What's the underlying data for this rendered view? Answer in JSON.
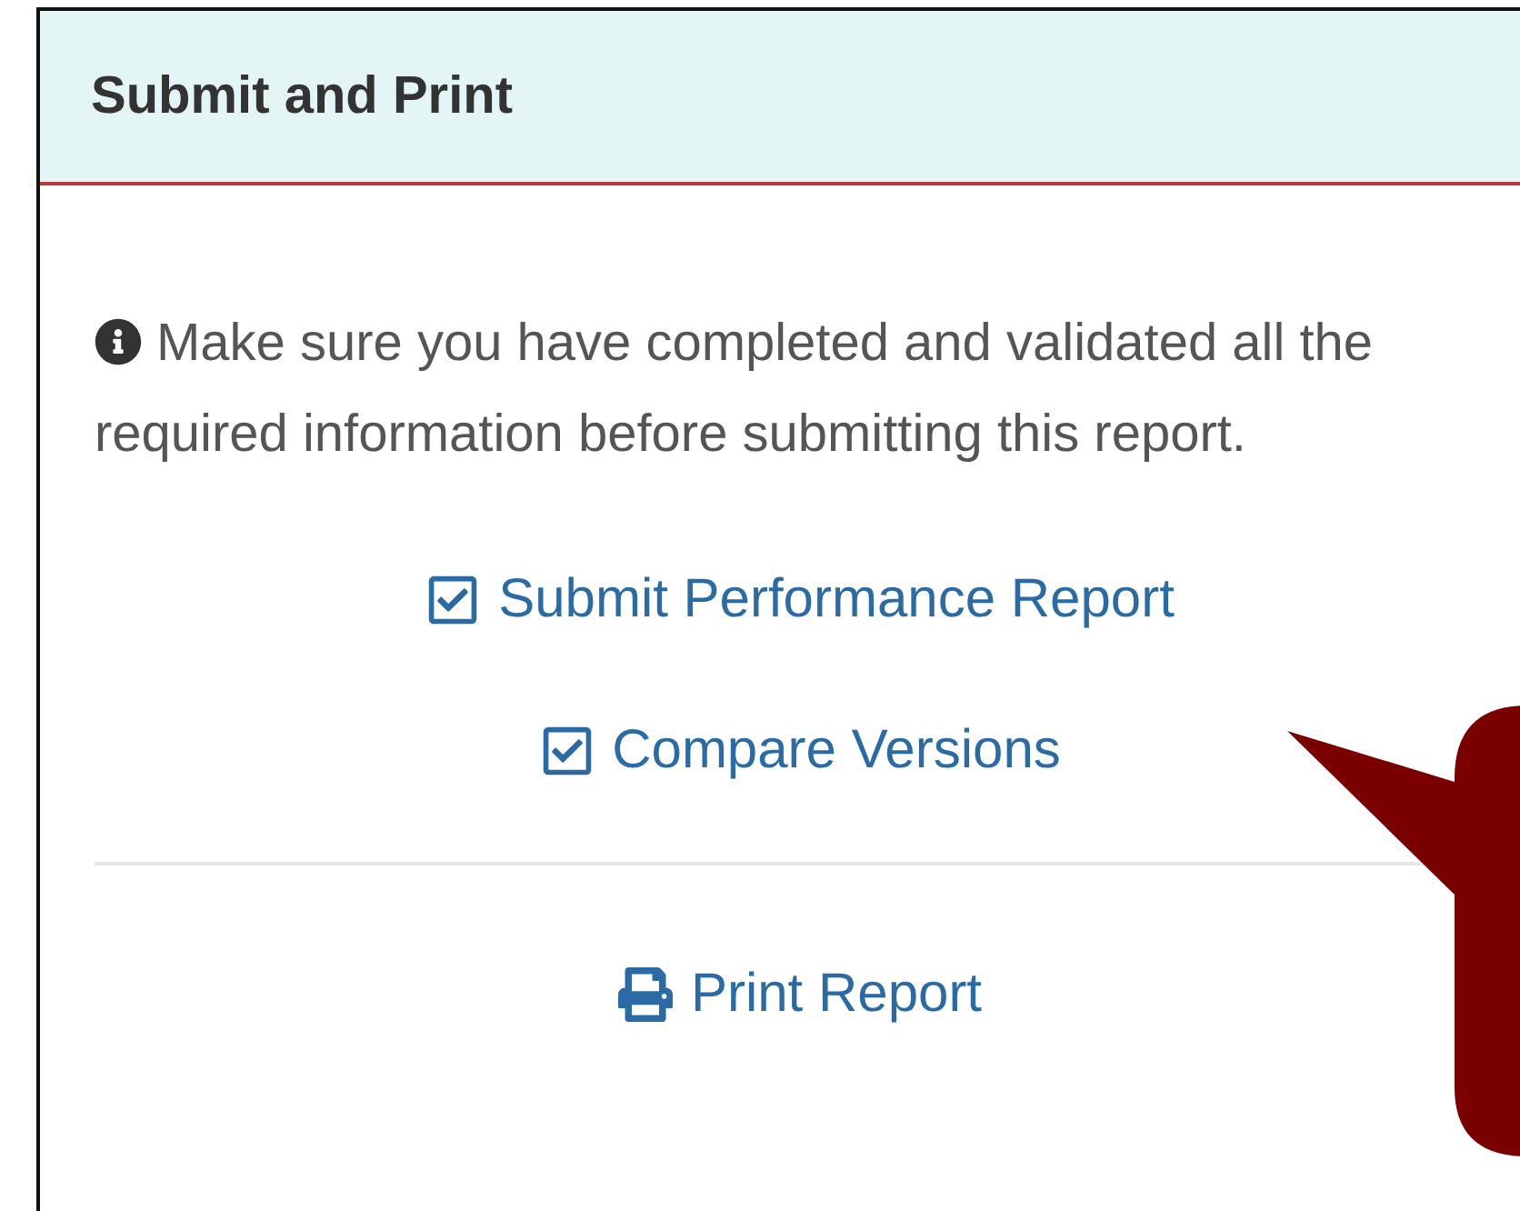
{
  "panel": {
    "title": "Submit and Print",
    "notice": "Make sure you have completed and validated all the required information before submitting this report.",
    "actions": [
      {
        "kind": "check",
        "label": "Submit Performance Report"
      },
      {
        "kind": "check",
        "label": "Compare Versions"
      }
    ],
    "footer_actions": [
      {
        "kind": "print",
        "label": "Print Report"
      }
    ]
  }
}
